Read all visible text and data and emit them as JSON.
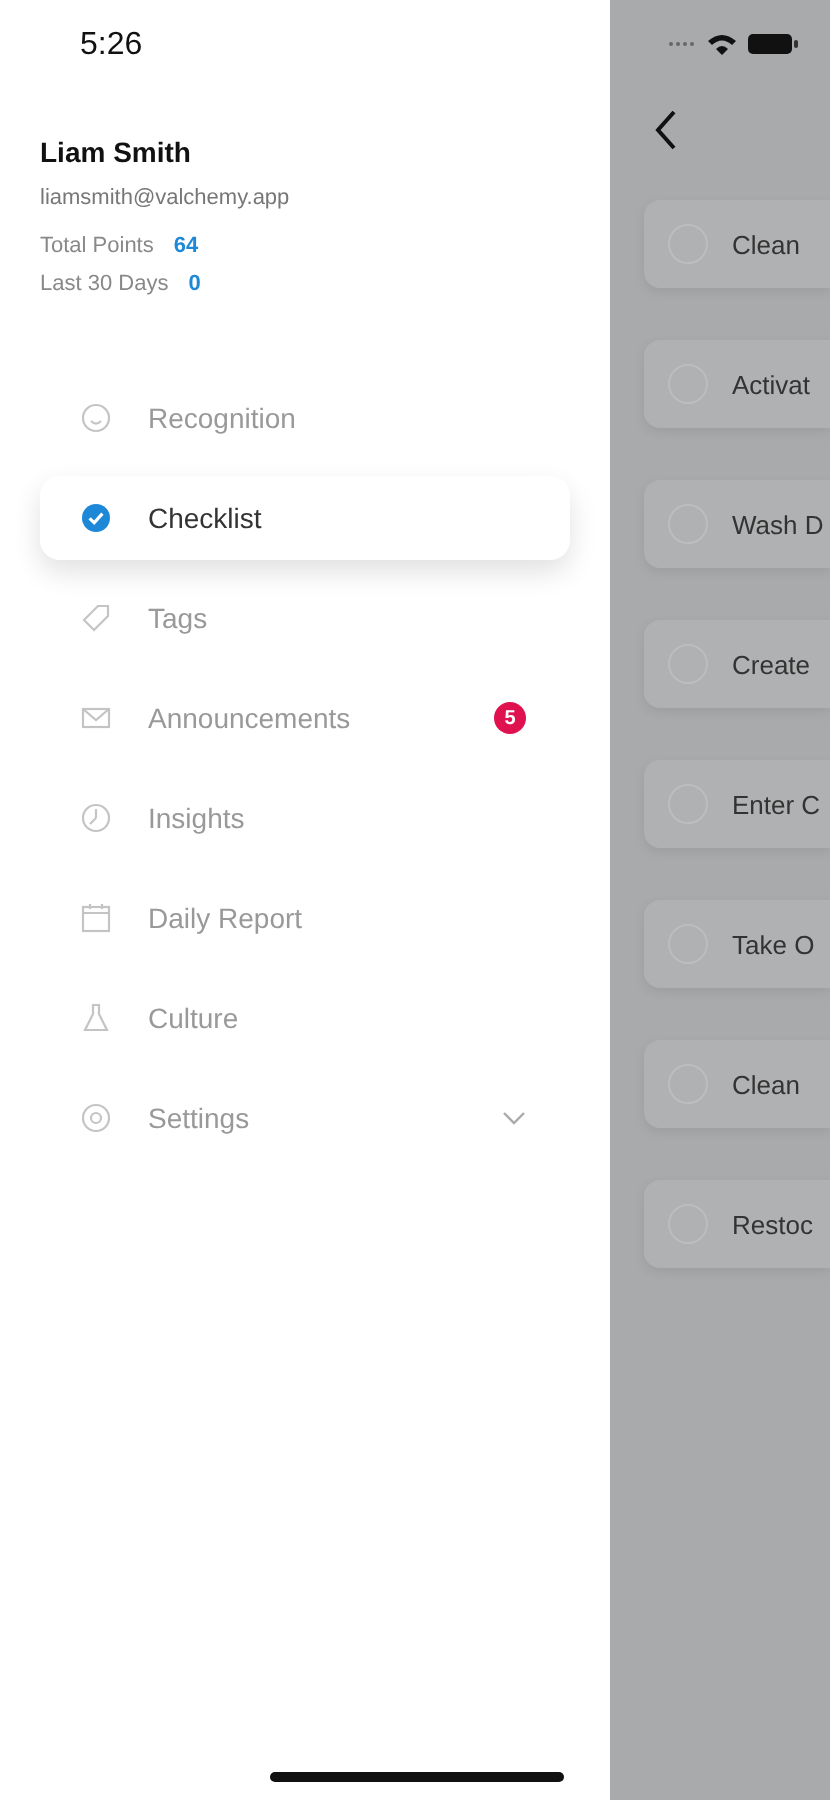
{
  "status_bar": {
    "time": "5:26"
  },
  "profile": {
    "name": "Liam Smith",
    "email": "liamsmith@valchemy.app",
    "stats": [
      {
        "label": "Total Points",
        "value": "64"
      },
      {
        "label": "Last 30 Days",
        "value": "0"
      }
    ]
  },
  "menu": [
    {
      "label": "Recognition",
      "selected": false,
      "kind": "link"
    },
    {
      "label": "Checklist",
      "selected": true,
      "kind": "link"
    },
    {
      "label": "Tags",
      "selected": false,
      "kind": "link"
    },
    {
      "label": "Announcements",
      "selected": false,
      "kind": "link",
      "badge": "5"
    },
    {
      "label": "Insights",
      "selected": false,
      "kind": "link"
    },
    {
      "label": "Daily Report",
      "selected": false,
      "kind": "link"
    },
    {
      "label": "Culture",
      "selected": false,
      "kind": "link"
    },
    {
      "label": "Settings",
      "selected": false,
      "kind": "expandable"
    }
  ],
  "checklist": [
    {
      "label": "Clean",
      "checked": false
    },
    {
      "label": "Activat",
      "checked": false
    },
    {
      "label": "Wash D",
      "checked": false
    },
    {
      "label": "Create",
      "checked": false
    },
    {
      "label": "Enter C",
      "checked": false
    },
    {
      "label": "Take O",
      "checked": false
    },
    {
      "label": "Clean",
      "checked": false
    },
    {
      "label": "Restoc",
      "checked": false
    }
  ]
}
